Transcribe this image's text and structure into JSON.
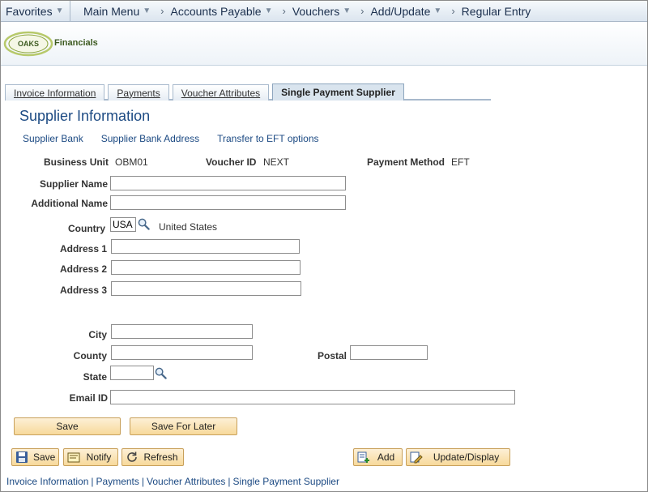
{
  "nav": {
    "favorites": "Favorites",
    "main_menu": "Main Menu",
    "crumbs": [
      "Accounts Payable",
      "Vouchers",
      "Add/Update",
      "Regular Entry"
    ]
  },
  "brand": {
    "logo_word": "OAKS",
    "logo_text": "Financials"
  },
  "tabs": [
    "Invoice Information",
    "Payments",
    "Voucher Attributes",
    "Single Payment Supplier"
  ],
  "page": {
    "title": "Supplier Information",
    "links": [
      "Supplier Bank",
      "Supplier Bank Address",
      "Transfer to EFT options"
    ]
  },
  "form": {
    "business_unit_label": "Business Unit",
    "business_unit": "OBM01",
    "voucher_id_label": "Voucher ID",
    "voucher_id": "NEXT",
    "payment_method_label": "Payment Method",
    "payment_method": "EFT",
    "supplier_name_label": "Supplier Name",
    "supplier_name": "",
    "additional_name_label": "Additional Name",
    "additional_name": "",
    "country_label": "Country",
    "country": "USA",
    "country_desc": "United States",
    "address1_label": "Address 1",
    "address1": "",
    "address2_label": "Address 2",
    "address2": "",
    "address3_label": "Address 3",
    "address3": "",
    "city_label": "City",
    "city": "",
    "county_label": "County",
    "county": "",
    "postal_label": "Postal",
    "postal": "",
    "state_label": "State",
    "state": "",
    "email_label": "Email ID",
    "email": ""
  },
  "buttons": {
    "save": "Save",
    "save_for_later": "Save For Later"
  },
  "toolbar": {
    "save": "Save",
    "notify": "Notify",
    "refresh": "Refresh",
    "add": "Add",
    "update_display": "Update/Display"
  },
  "bottom_links": [
    "Invoice Information",
    "Payments",
    "Voucher Attributes",
    "Single Payment Supplier"
  ]
}
